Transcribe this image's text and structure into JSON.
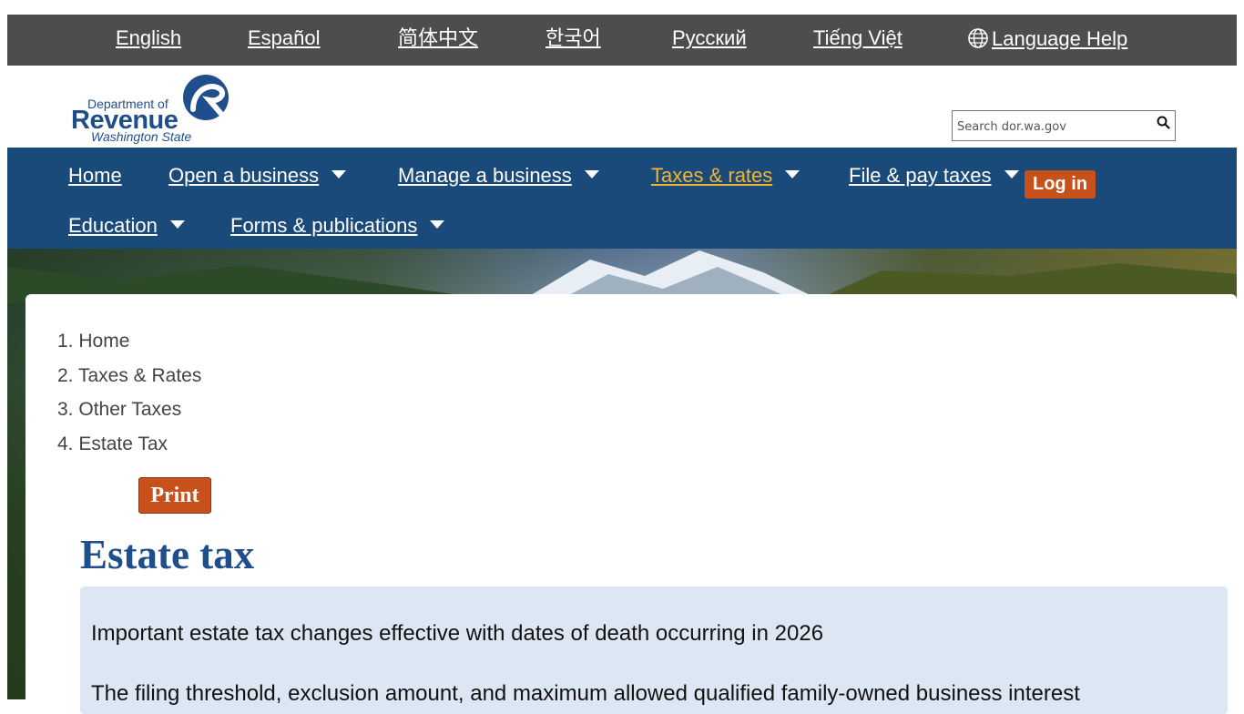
{
  "languages": [
    {
      "label": "English"
    },
    {
      "label": "Español"
    },
    {
      "label": "简体中文"
    },
    {
      "label": "한국어"
    },
    {
      "label": "Русский"
    },
    {
      "label": "Tiếng Việt"
    }
  ],
  "language_help": "Language Help",
  "logo": {
    "line1": "Department of",
    "line2": "Revenue",
    "line3": "Washington State"
  },
  "search": {
    "placeholder": "Search dor.wa.gov"
  },
  "nav": {
    "items": [
      {
        "label": "Home"
      },
      {
        "label": "Open a business"
      },
      {
        "label": "Manage a business"
      },
      {
        "label": "Taxes & rates"
      },
      {
        "label": "File & pay taxes"
      },
      {
        "label": "Education"
      },
      {
        "label": "Forms & publications"
      }
    ],
    "active_color": "#f1b434",
    "login_label": "Log in"
  },
  "breadcrumb": [
    "Home",
    "Taxes & Rates",
    "Other Taxes",
    "Estate Tax"
  ],
  "print_label": "Print",
  "page_title": "Estate tax",
  "notice": {
    "line1": "Important estate tax changes effective with dates of death occurring in 2026",
    "line2": "The filing threshold, exclusion amount, and maximum allowed qualified family-owned business interest"
  },
  "colors": {
    "nav_bg": "#1a4a7a",
    "lang_bg": "#4d4d4d",
    "accent": "#c8511b",
    "title": "#1f4e8c",
    "notice_bg": "#dde7f4"
  }
}
